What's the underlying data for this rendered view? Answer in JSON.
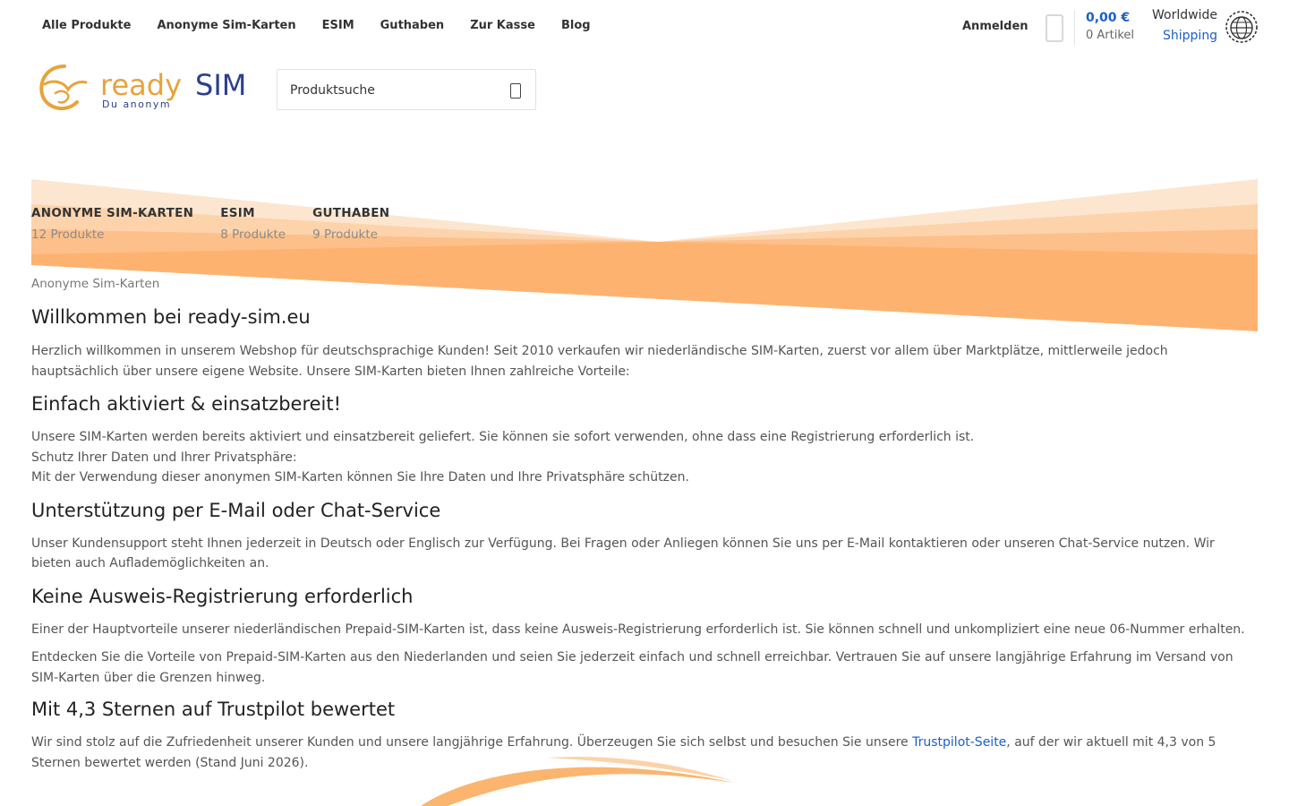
{
  "nav": {
    "items": [
      "Alle Produkte",
      "Anonyme Sim-Karten",
      "ESIM",
      "Guthaben",
      "Zur Kasse",
      "Blog"
    ],
    "login": "Anmelden",
    "cart_total": "0,00 €",
    "cart_count": "0 Artikel",
    "shipping_line1": "Worldwide",
    "shipping_line2": "Shipping"
  },
  "logo": {
    "brand_ready": "ready",
    "brand_sim": "SIM",
    "tagline": "Du anonym",
    "colors": {
      "ready": "#e8a33a",
      "sim": "#2a3f8f"
    }
  },
  "search": {
    "placeholder": "Produktsuche"
  },
  "categories": [
    {
      "name": "ANONYME SIM-KARTEN",
      "count": "12 Produkte"
    },
    {
      "name": "ESIM",
      "count": "8 Produkte"
    },
    {
      "name": "GUTHABEN",
      "count": "9 Produkte"
    }
  ],
  "breadcrumb": "Anonyme Sim-Karten",
  "sections": {
    "welcome": {
      "title": "Willkommen bei ready-sim.eu",
      "text": "Herzlich willkommen in unserem Webshop für deutschsprachige Kunden! Seit 2010 verkaufen wir niederländische SIM-Karten, zuerst vor allem über Marktplätze, mittlerweile jedoch hauptsächlich über unsere eigene Website. Unsere SIM-Karten bieten Ihnen zahlreiche Vorteile:"
    },
    "activated": {
      "title": "Einfach aktiviert & einsatzbereit!",
      "line1": "Unsere SIM-Karten werden bereits aktiviert und einsatzbereit geliefert. Sie können sie sofort verwenden, ohne dass eine Registrierung erforderlich ist.",
      "line2": "Schutz Ihrer Daten und Ihrer Privatsphäre:",
      "line3": "Mit der Verwendung dieser anonymen SIM-Karten können Sie Ihre Daten und Ihre Privatsphäre schützen."
    },
    "support": {
      "title": "Unterstützung per E-Mail oder Chat-Service",
      "text": "Unser Kundensupport steht Ihnen jederzeit in Deutsch oder Englisch zur Verfügung. Bei Fragen oder Anliegen können Sie uns per E-Mail kontaktieren oder unseren Chat-Service nutzen. Wir bieten auch Auflademöglichkeiten an."
    },
    "no_id": {
      "title": "Keine Ausweis-Registrierung erforderlich",
      "text1": "Einer der Hauptvorteile unserer niederländischen Prepaid-SIM-Karten ist, dass keine Ausweis-Registrierung erforderlich ist. Sie können schnell und unkompliziert eine neue 06-Nummer erhalten.",
      "text2": "Entdecken Sie die Vorteile von Prepaid-SIM-Karten aus den Niederlanden und seien Sie jederzeit einfach und schnell erreichbar. Vertrauen Sie auf unsere langjährige Erfahrung im Versand von SIM-Karten über die Grenzen hinweg."
    },
    "trustpilot": {
      "title": "Mit 4,3 Sternen auf Trustpilot bewertet",
      "text_before": "Wir sind stolz auf die Zufriedenheit unserer Kunden und unsere langjährige Erfahrung. Überzeugen Sie sich selbst und besuchen Sie unsere ",
      "link": "Trustpilot-Seite",
      "text_after": ", auf der wir aktuell mit 4,3 von 5 Sternen bewertet werden (Stand Juni 2026)."
    }
  },
  "colors": {
    "accent_blue": "#1a5fc8",
    "banner_orange": "#fdb36f",
    "banner_light": "#fde3c8"
  }
}
